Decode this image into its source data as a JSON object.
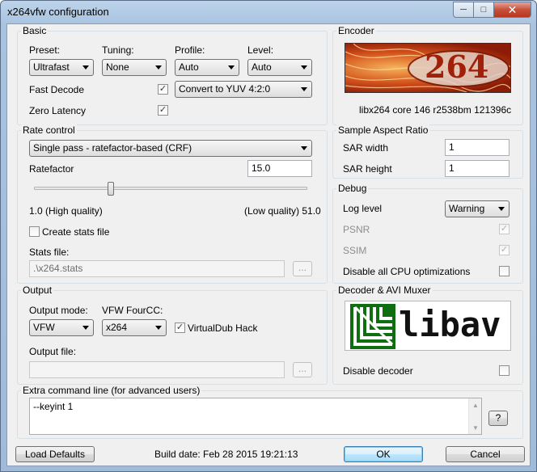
{
  "window": {
    "title": "x264vfw configuration"
  },
  "basic": {
    "group_label": "Basic",
    "preset_label": "Preset:",
    "preset_value": "Ultrafast",
    "tuning_label": "Tuning:",
    "tuning_value": "None",
    "profile_label": "Profile:",
    "profile_value": "Auto",
    "level_label": "Level:",
    "level_value": "Auto",
    "fast_decode_label": "Fast Decode",
    "fast_decode_checked": true,
    "zero_latency_label": "Zero Latency",
    "zero_latency_checked": true,
    "colorspace_value": "Convert to YUV 4:2:0"
  },
  "encoder": {
    "group_label": "Encoder",
    "logo_text": "264",
    "version": "libx264 core 146 r2538bm 121396c"
  },
  "rate_control": {
    "group_label": "Rate control",
    "mode_value": "Single pass - ratefactor-based (CRF)",
    "ratefactor_label": "Ratefactor",
    "ratefactor_value": "15.0",
    "slider_fraction": 0.28,
    "min_label": "1.0 (High quality)",
    "max_label": "(Low quality) 51.0",
    "create_stats_label": "Create stats file",
    "create_stats_checked": false,
    "stats_file_label": "Stats file:",
    "stats_file_value": ".\\x264.stats",
    "browse_label": "..."
  },
  "sar": {
    "group_label": "Sample Aspect Ratio",
    "width_label": "SAR width",
    "width_value": "1",
    "height_label": "SAR height",
    "height_value": "1"
  },
  "debug": {
    "group_label": "Debug",
    "log_level_label": "Log level",
    "log_level_value": "Warning",
    "psnr_label": "PSNR",
    "psnr_checked": true,
    "ssim_label": "SSIM",
    "ssim_checked": true,
    "disable_cpu_label": "Disable all CPU optimizations",
    "disable_cpu_checked": false
  },
  "output": {
    "group_label": "Output",
    "mode_label": "Output mode:",
    "mode_value": "VFW",
    "fourcc_label": "VFW FourCC:",
    "fourcc_value": "x264",
    "vdub_label": "VirtualDub Hack",
    "vdub_checked": true,
    "file_label": "Output file:",
    "file_value": "",
    "browse_label": "..."
  },
  "decoder": {
    "group_label": "Decoder & AVI Muxer",
    "logo_text": "libav",
    "disable_label": "Disable decoder",
    "disable_checked": false
  },
  "extra": {
    "group_label": "Extra command line (for advanced users)",
    "value": "--keyint 1",
    "help_label": "?"
  },
  "footer": {
    "load_defaults_label": "Load Defaults",
    "build_date": "Build date: Feb 28 2015 19:21:13",
    "ok_label": "OK",
    "cancel_label": "Cancel"
  },
  "colors": {
    "logo_264_bg": "#b8270d",
    "libav_green": "#2a8a1c"
  },
  "icons": {
    "check": "✓",
    "minimize": "─",
    "maximize": "□",
    "close": "✕",
    "scroll_up": "▲",
    "scroll_down": "▼"
  }
}
